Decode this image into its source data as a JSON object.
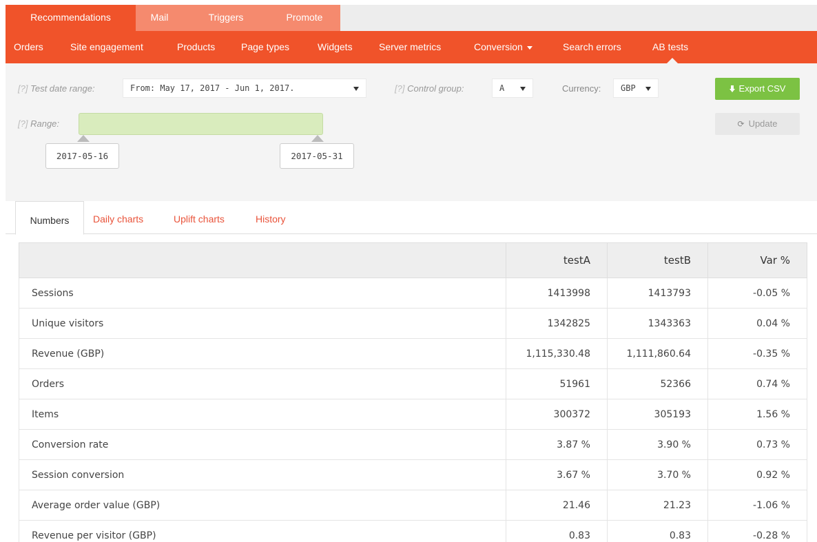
{
  "top_tabs": [
    {
      "label": "Recommendations",
      "active": true
    },
    {
      "label": "Mail",
      "active": false
    },
    {
      "label": "Triggers",
      "active": false
    },
    {
      "label": "Promote",
      "active": false
    }
  ],
  "sub_nav": [
    {
      "label": "Orders"
    },
    {
      "label": "Site engagement"
    },
    {
      "label": "Products"
    },
    {
      "label": "Page types"
    },
    {
      "label": "Widgets"
    },
    {
      "label": "Server metrics"
    },
    {
      "label": "Conversion"
    },
    {
      "label": "Search errors"
    },
    {
      "label": "AB tests",
      "active": true
    }
  ],
  "filters": {
    "help_marker": "[?]",
    "test_date_range_label": "Test date range:",
    "test_date_range_value": "From: May 17, 2017 - Jun 1, 2017.",
    "control_group_label": "Control group:",
    "control_group_value": "A",
    "currency_label": "Currency:",
    "currency_value": "GBP",
    "range_label": "Range:",
    "range_start": "2017-05-16",
    "range_end": "2017-05-31",
    "export_label": "Export CSV",
    "update_label": "Update"
  },
  "content_tabs": [
    {
      "label": "Numbers",
      "active": true
    },
    {
      "label": "Daily charts"
    },
    {
      "label": "Uplift charts"
    },
    {
      "label": "History"
    }
  ],
  "table": {
    "columns": [
      "",
      "testA",
      "testB",
      "Var %"
    ],
    "rows": [
      [
        "Sessions",
        "1413998",
        "1413793",
        "-0.05 %"
      ],
      [
        "Unique visitors",
        "1342825",
        "1343363",
        "0.04 %"
      ],
      [
        "Revenue (GBP)",
        "1,115,330.48",
        "1,111,860.64",
        "-0.35 %"
      ],
      [
        "Orders",
        "51961",
        "52366",
        "0.74 %"
      ],
      [
        "Items",
        "300372",
        "305193",
        "1.56 %"
      ],
      [
        "Conversion rate",
        "3.87 %",
        "3.90 %",
        "0.73 %"
      ],
      [
        "Session conversion",
        "3.67 %",
        "3.70 %",
        "0.92 %"
      ],
      [
        "Average order value (GBP)",
        "21.46",
        "21.23",
        "-1.06 %"
      ],
      [
        "Revenue per visitor (GBP)",
        "0.83",
        "0.83",
        "-0.28 %"
      ]
    ]
  },
  "colors": {
    "brand_orange": "#f0532a",
    "tab_inactive": "#f58a6e",
    "export_green": "#7cc243",
    "link_red": "#e9533a"
  }
}
